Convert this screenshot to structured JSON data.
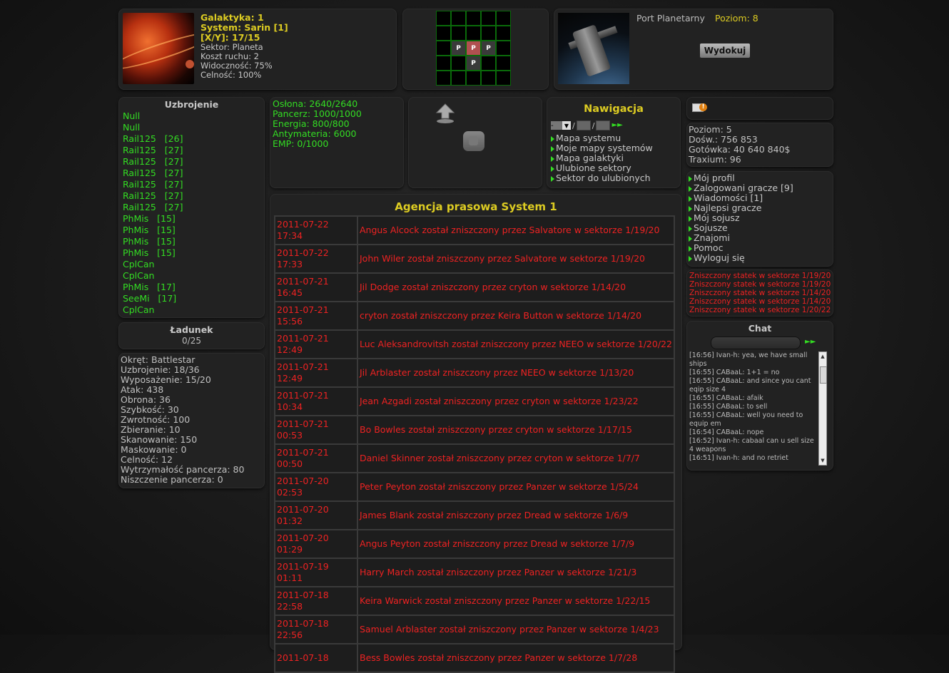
{
  "location": {
    "galaxy": "Galaktyka: 1",
    "system": "System: Sarin [1]",
    "xy": "[X/Y]: 17/15",
    "sector": "Sektor: Planeta",
    "move_cost": "Koszt ruchu: 2",
    "visibility": "Widoczność: 75%",
    "accuracy": "Celność: 100%",
    "image_icon": "planet-image"
  },
  "minimap": {
    "rows": [
      [
        "",
        "",
        "",
        "",
        ""
      ],
      [
        "",
        "",
        "",
        "",
        ""
      ],
      [
        "",
        "P",
        "P",
        "P",
        ""
      ],
      [
        "",
        "",
        "P",
        "",
        ""
      ],
      [
        "",
        "",
        "",
        "",
        ""
      ]
    ],
    "current": [
      2,
      2
    ]
  },
  "port": {
    "label": "Port Planetarny",
    "level": "Poziom: 8",
    "undock_button": "Wydokuj"
  },
  "weapons": {
    "title": "Uzbrojenie",
    "items": [
      "Null",
      "Null",
      "Rail125   [26]",
      "Rail125   [27]",
      "Rail125   [27]",
      "Rail125   [27]",
      "Rail125   [27]",
      "Rail125   [27]",
      "Rail125   [27]",
      "PhMis   [15]",
      "PhMis   [15]",
      "PhMis   [15]",
      "PhMis   [15]",
      "CplCan",
      "CplCan",
      "PhMis   [17]",
      "SeeMi   [17]",
      "CplCan"
    ]
  },
  "cargo": {
    "title": "Ładunek",
    "value": "0/25"
  },
  "ship": {
    "stats": [
      "Okręt: Battlestar",
      "Uzbrojenie: 18/36",
      "Wyposażenie: 15/20",
      "Atak: 438",
      "Obrona: 36",
      "Szybkość: 30",
      "Zwrotność: 100",
      "Zbieranie: 10",
      "Skanowanie: 150",
      "Maskowanie: 0",
      "Celność: 12",
      "Wytrzymałość pancerza: 80",
      "Niszczenie pancerza: 0"
    ]
  },
  "status": {
    "shield": "Osłona: 2640/2640",
    "armor": "Pancerz: 1000/1000",
    "energy": "Energia: 800/800",
    "antimatter": "Antymateria: 6000",
    "emp": "EMP: 0/1000"
  },
  "nav": {
    "title": "Nawigacja",
    "select_value": "-",
    "links": [
      "Mapa systemu",
      "Moje mapy systemów",
      "Mapa galaktyki",
      "Ulubione sektory",
      "Sektor do ulubionych"
    ]
  },
  "news": {
    "title": "Agencja prasowa System 1",
    "rows": [
      {
        "date": "2011-07-22 17:34",
        "text": "Angus Alcock został zniszczony przez Salvatore w sektorze 1/19/20"
      },
      {
        "date": "2011-07-22 17:33",
        "text": "John Wiler został zniszczony przez Salvatore w sektorze 1/19/20"
      },
      {
        "date": "2011-07-21 16:45",
        "text": "Jil Dodge został zniszczony przez cryton w sektorze 1/14/20"
      },
      {
        "date": "2011-07-21 15:56",
        "text": "cryton został zniszczony przez Keira Button w sektorze 1/14/20"
      },
      {
        "date": "2011-07-21 12:49",
        "text": "Luc Aleksandrovitsh został zniszczony przez NEEO w sektorze 1/20/22"
      },
      {
        "date": "2011-07-21 12:49",
        "text": "Jil Arblaster został zniszczony przez NEEO w sektorze 1/13/20"
      },
      {
        "date": "2011-07-21 10:34",
        "text": "Jean Azgadi został zniszczony przez cryton w sektorze 1/23/22"
      },
      {
        "date": "2011-07-21 00:53",
        "text": "Bo Bowles został zniszczony przez cryton w sektorze 1/17/15"
      },
      {
        "date": "2011-07-21 00:50",
        "text": "Daniel Skinner został zniszczony przez cryton w sektorze 1/7/7"
      },
      {
        "date": "2011-07-20 02:53",
        "text": "Peter Peyton został zniszczony przez Panzer w sektorze 1/5/24"
      },
      {
        "date": "2011-07-20 01:32",
        "text": "James Blank został zniszczony przez Dread w sektorze 1/6/9"
      },
      {
        "date": "2011-07-20 01:29",
        "text": "Angus Peyton został zniszczony przez Dread w sektorze 1/7/9"
      },
      {
        "date": "2011-07-19 01:11",
        "text": "Harry March został zniszczony przez Panzer w sektorze 1/21/3"
      },
      {
        "date": "2011-07-18 22:58",
        "text": "Keira Warwick został zniszczony przez Panzer w sektorze 1/22/15"
      },
      {
        "date": "2011-07-18 22:56",
        "text": "Samuel Arblaster został zniszczony przez Panzer w sektorze 1/4/23"
      },
      {
        "date": "2011-07-18",
        "text": "Bess Bowles został zniszczony przez Panzer w sektorze 1/7/28"
      }
    ]
  },
  "player": {
    "level": "Poziom: 5",
    "exp": "Dośw.: 756 853",
    "cash": "Gotówka: 40 640 840$",
    "traxium": "Traxium: 96"
  },
  "menu": {
    "links": [
      "Mój profil",
      "Zalogowani gracze [9]",
      "Wiadomości [1]",
      "Najlepsi gracze",
      "Mój sojusz",
      "Sojusze",
      "Znajomi",
      "Pomoc",
      "Wyloguj się"
    ]
  },
  "alerts": [
    "Zniszczony statek w sektorze 1/19/20",
    "Zniszczony statek w sektorze 1/19/20",
    "Zniszczony statek w sektorze 1/14/20",
    "Zniszczony statek w sektorze 1/14/20",
    "Zniszczony statek w sektorze 1/20/22"
  ],
  "chat": {
    "title": "Chat",
    "messages": [
      "[16:56] Ivan-h: yea, we have small ships",
      "[16:55] CABaaL: 1+1 = no",
      "[16:55] CABaaL: and since you cant eqip size 4",
      "[16:55] CABaaL: afaik",
      "[16:55] CABaaL: to sell",
      "[16:55] CABaaL: well you need to equip em",
      "[16:54] CABaaL: nope",
      "[16:52] Ivan-h: cabaal can u sell size 4 weapons",
      "[16:51] Ivan-h: and no retriet"
    ]
  },
  "colors": {
    "accent_yellow": "#ddcc22",
    "accent_green": "#33dd22",
    "alert_red": "#ee2222"
  }
}
